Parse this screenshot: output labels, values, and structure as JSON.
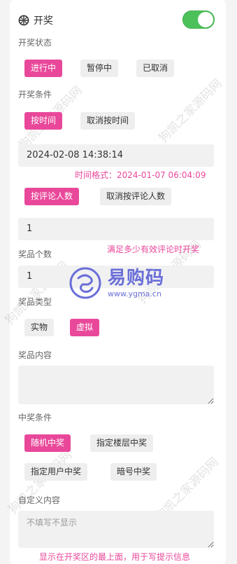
{
  "header": {
    "title": "开奖",
    "toggle_on": true
  },
  "status": {
    "label": "开奖状态",
    "options": [
      {
        "label": "进行中",
        "active": true
      },
      {
        "label": "暂停中",
        "active": false
      },
      {
        "label": "已取消",
        "active": false
      }
    ]
  },
  "condition": {
    "label": "开奖条件",
    "time_options": [
      {
        "label": "按时间",
        "active": true
      },
      {
        "label": "取消按时间",
        "active": false
      }
    ],
    "time_value": "2024-02-08 14:38:14",
    "time_hint": "时间格式：2024-01-07 06:04:09",
    "comment_options": [
      {
        "label": "按评论人数",
        "active": true
      },
      {
        "label": "取消按评论人数",
        "active": false
      }
    ],
    "comment_value": "1",
    "comment_hint": "满足多少有效评论时开奖"
  },
  "prize_count": {
    "label": "奖品个数",
    "value": "1"
  },
  "prize_type": {
    "label": "奖品类型",
    "options": [
      {
        "label": "实物",
        "active": false
      },
      {
        "label": "虚拟",
        "active": true
      }
    ]
  },
  "prize_content": {
    "label": "奖品内容",
    "value": ""
  },
  "win_condition": {
    "label": "中奖条件",
    "options": [
      {
        "label": "随机中奖",
        "active": true
      },
      {
        "label": "指定楼层中奖",
        "active": false
      },
      {
        "label": "指定用户中奖",
        "active": false
      },
      {
        "label": "暗号中奖",
        "active": false
      }
    ]
  },
  "custom": {
    "label": "自定义内容",
    "placeholder": "不填写不显示",
    "hint": "显示在开奖区的最上面，用于写提示信息"
  },
  "logo": {
    "text": "易购码",
    "url": "www.ygma.cn"
  },
  "watermarks": [
    "狗凯之家源码网",
    "狗凯之家源码网",
    "狗凯之家源码网",
    "狗凯之家源码网",
    "狗凯之家源码网",
    "狗凯之家源码网"
  ],
  "colors": {
    "accent": "#e9489a",
    "toggle": "#4cc15a",
    "logo": "#6a6fd8"
  }
}
